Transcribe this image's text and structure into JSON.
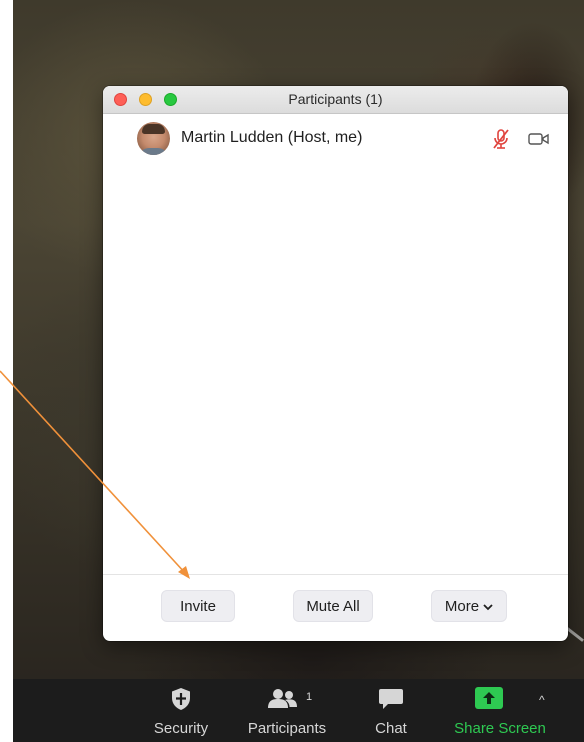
{
  "window": {
    "title": "Participants (1)"
  },
  "participants": [
    {
      "name": "Martin Ludden (Host, me)",
      "mic": "muted",
      "video": "off"
    }
  ],
  "footer": {
    "invite_label": "Invite",
    "mute_all_label": "Mute All",
    "more_label": "More"
  },
  "toolbar": {
    "security_label": "Security",
    "participants_label": "Participants",
    "participants_count": "1",
    "chat_label": "Chat",
    "share_label": "Share Screen"
  },
  "icons": {
    "security": "shield-icon",
    "participants": "people-icon",
    "chat": "chat-bubble-icon",
    "share": "share-up-arrow-icon",
    "mic": "mic-muted-icon",
    "video": "video-off-icon"
  },
  "colors": {
    "share_green": "#2ec952",
    "muted_red": "#e0443e",
    "arrow_orange": "#f0913a",
    "toolbar_bg": "#1c1c1c"
  }
}
